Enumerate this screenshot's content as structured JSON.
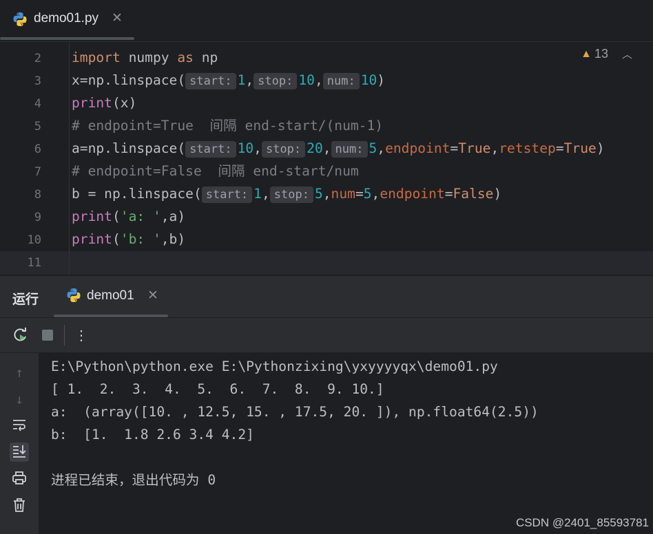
{
  "editor_tab": {
    "filename": "demo01.py",
    "close": "✕"
  },
  "editor": {
    "warnings_count": "13",
    "line_numbers": [
      "2",
      "3",
      "4",
      "5",
      "6",
      "7",
      "8",
      "9",
      "10",
      "11"
    ],
    "lines": [
      [
        {
          "t": "import",
          "c": "kw"
        },
        {
          "t": " numpy ",
          "c": ""
        },
        {
          "t": "as",
          "c": "kw"
        },
        {
          "t": " np",
          "c": ""
        }
      ],
      [
        {
          "t": "x=np.linspace(",
          "c": ""
        },
        {
          "t": "start:",
          "c": "hint"
        },
        {
          "t": "1",
          "c": "num"
        },
        {
          "t": ",",
          "c": ""
        },
        {
          "t": "stop:",
          "c": "hint"
        },
        {
          "t": "10",
          "c": "num"
        },
        {
          "t": ",",
          "c": ""
        },
        {
          "t": "num:",
          "c": "hint"
        },
        {
          "t": "10",
          "c": "num"
        },
        {
          "t": ")",
          "c": ""
        }
      ],
      [
        {
          "t": "print",
          "c": "bi"
        },
        {
          "t": "(x)",
          "c": ""
        }
      ],
      [
        {
          "t": "# endpoint=True  间隔 end-start/(num-1)",
          "c": "comment"
        }
      ],
      [
        {
          "t": "a=np.linspace(",
          "c": ""
        },
        {
          "t": "start:",
          "c": "hint"
        },
        {
          "t": "10",
          "c": "num"
        },
        {
          "t": ",",
          "c": ""
        },
        {
          "t": "stop:",
          "c": "hint"
        },
        {
          "t": "20",
          "c": "num"
        },
        {
          "t": ",",
          "c": ""
        },
        {
          "t": "num:",
          "c": "hint"
        },
        {
          "t": "5",
          "c": "num"
        },
        {
          "t": ",",
          "c": ""
        },
        {
          "t": "endpoint",
          "c": "kwarg"
        },
        {
          "t": "=",
          "c": ""
        },
        {
          "t": "True",
          "c": "kwv"
        },
        {
          "t": ",",
          "c": ""
        },
        {
          "t": "retstep",
          "c": "kwarg"
        },
        {
          "t": "=",
          "c": ""
        },
        {
          "t": "True",
          "c": "kwv"
        },
        {
          "t": ")",
          "c": ""
        }
      ],
      [
        {
          "t": "# endpoint=False  间隔 end-start/num",
          "c": "comment"
        }
      ],
      [
        {
          "t": "b = np.linspace(",
          "c": ""
        },
        {
          "t": "start:",
          "c": "hint"
        },
        {
          "t": "1",
          "c": "num"
        },
        {
          "t": ",",
          "c": ""
        },
        {
          "t": "stop:",
          "c": "hint"
        },
        {
          "t": "5",
          "c": "num"
        },
        {
          "t": ",",
          "c": ""
        },
        {
          "t": "num",
          "c": "kwarg"
        },
        {
          "t": "=",
          "c": ""
        },
        {
          "t": "5",
          "c": "num"
        },
        {
          "t": ",",
          "c": ""
        },
        {
          "t": "endpoint",
          "c": "kwarg"
        },
        {
          "t": "=",
          "c": ""
        },
        {
          "t": "False",
          "c": "kwv"
        },
        {
          "t": ")",
          "c": ""
        }
      ],
      [
        {
          "t": "print",
          "c": "bi"
        },
        {
          "t": "(",
          "c": ""
        },
        {
          "t": "'a: '",
          "c": "str"
        },
        {
          "t": ",a)",
          "c": ""
        }
      ],
      [
        {
          "t": "print",
          "c": "bi"
        },
        {
          "t": "(",
          "c": ""
        },
        {
          "t": "'b: '",
          "c": "str"
        },
        {
          "t": ",b)",
          "c": ""
        }
      ],
      []
    ]
  },
  "run_panel": {
    "title": "运行",
    "tab_label": "demo01",
    "close": "✕"
  },
  "console": {
    "lines": [
      "E:\\Python\\python.exe E:\\Pythonzixing\\yxyyyyqx\\demo01.py",
      "[ 1.  2.  3.  4.  5.  6.  7.  8.  9. 10.]",
      "a:  (array([10. , 12.5, 15. , 17.5, 20. ]), np.float64(2.5))",
      "b:  [1.  1.8 2.6 3.4 4.2]",
      "",
      "进程已结束，退出代码为 0"
    ]
  },
  "watermark": "CSDN @2401_85593781",
  "colors": {
    "background": "#1e1f22",
    "panel": "#2b2d30",
    "keyword": "#cf8e6d",
    "number": "#2aacb8",
    "string": "#6aab73",
    "builtin": "#c77dbb",
    "comment": "#7a7e85",
    "warning": "#e0a34a"
  }
}
